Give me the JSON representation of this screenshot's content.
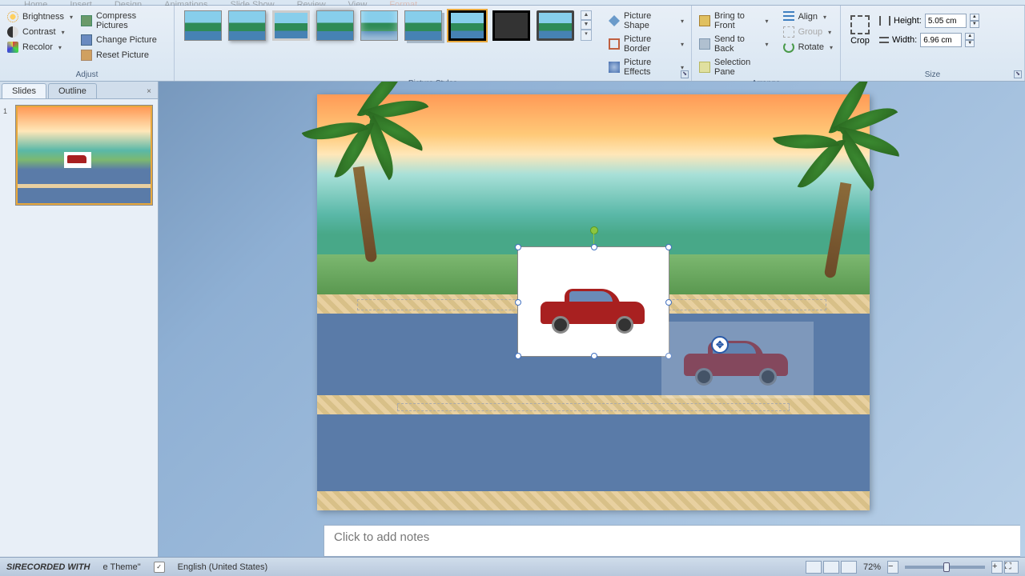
{
  "menubar": [
    "Home",
    "Insert",
    "Design",
    "Animations",
    "Slide Show",
    "Review",
    "View",
    "Format"
  ],
  "ribbon": {
    "adjust": {
      "brightness": "Brightness",
      "contrast": "Contrast",
      "recolor": "Recolor",
      "compress": "Compress Pictures",
      "change": "Change Picture",
      "reset": "Reset Picture",
      "label": "Adjust"
    },
    "picture_styles": {
      "shape": "Picture Shape",
      "border": "Picture Border",
      "effects": "Picture Effects",
      "label": "Picture Styles"
    },
    "arrange": {
      "bring_front": "Bring to Front",
      "send_back": "Send to Back",
      "selection_pane": "Selection Pane",
      "align": "Align",
      "group": "Group",
      "rotate": "Rotate",
      "label": "Arrange"
    },
    "size": {
      "crop": "Crop",
      "height_label": "Height:",
      "width_label": "Width:",
      "height_value": "5.05 cm",
      "width_value": "6.96 cm",
      "label": "Size"
    }
  },
  "sidepane": {
    "tab_slides": "Slides",
    "tab_outline": "Outline",
    "slide_number": "1"
  },
  "notes_placeholder": "Click to add notes",
  "statusbar": {
    "recorded": "SIRECORDED WITH",
    "theme": "e Theme\"",
    "language": "English (United States)",
    "zoom": "72%"
  }
}
